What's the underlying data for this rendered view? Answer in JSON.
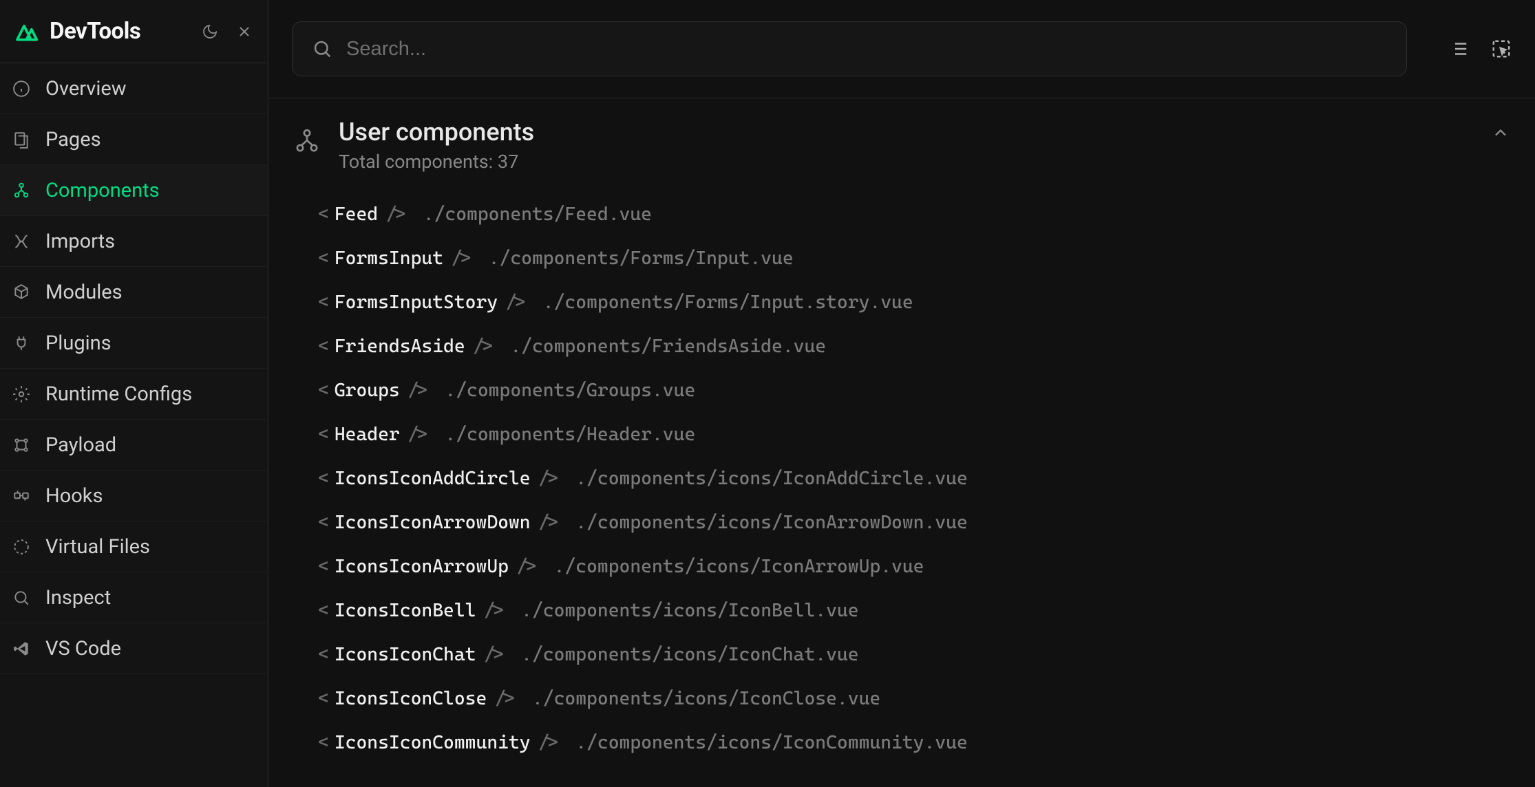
{
  "brand": "DevTools",
  "search": {
    "placeholder": "Search..."
  },
  "nav": {
    "items": [
      {
        "id": "overview",
        "label": "Overview"
      },
      {
        "id": "pages",
        "label": "Pages"
      },
      {
        "id": "components",
        "label": "Components"
      },
      {
        "id": "imports",
        "label": "Imports"
      },
      {
        "id": "modules",
        "label": "Modules"
      },
      {
        "id": "plugins",
        "label": "Plugins"
      },
      {
        "id": "runtime-configs",
        "label": "Runtime Configs"
      },
      {
        "id": "payload",
        "label": "Payload"
      },
      {
        "id": "hooks",
        "label": "Hooks"
      },
      {
        "id": "virtual-files",
        "label": "Virtual Files"
      },
      {
        "id": "inspect",
        "label": "Inspect"
      },
      {
        "id": "vscode",
        "label": "VS Code"
      }
    ],
    "active": "components"
  },
  "section": {
    "title": "User components",
    "subtitle_prefix": "Total components: ",
    "total": 37
  },
  "components": [
    {
      "name": "Feed",
      "path": "./components/Feed.vue"
    },
    {
      "name": "FormsInput",
      "path": "./components/Forms/Input.vue"
    },
    {
      "name": "FormsInputStory",
      "path": "./components/Forms/Input.story.vue"
    },
    {
      "name": "FriendsAside",
      "path": "./components/FriendsAside.vue"
    },
    {
      "name": "Groups",
      "path": "./components/Groups.vue"
    },
    {
      "name": "Header",
      "path": "./components/Header.vue"
    },
    {
      "name": "IconsIconAddCircle",
      "path": "./components/icons/IconAddCircle.vue"
    },
    {
      "name": "IconsIconArrowDown",
      "path": "./components/icons/IconArrowDown.vue"
    },
    {
      "name": "IconsIconArrowUp",
      "path": "./components/icons/IconArrowUp.vue"
    },
    {
      "name": "IconsIconBell",
      "path": "./components/icons/IconBell.vue"
    },
    {
      "name": "IconsIconChat",
      "path": "./components/icons/IconChat.vue"
    },
    {
      "name": "IconsIconClose",
      "path": "./components/icons/IconClose.vue"
    },
    {
      "name": "IconsIconCommunity",
      "path": "./components/icons/IconCommunity.vue"
    }
  ],
  "icons": {
    "overview": "info-icon",
    "pages": "pages-icon",
    "components": "tree-icon",
    "imports": "imports-icon",
    "modules": "modules-icon",
    "plugins": "plug-icon",
    "runtime-configs": "gear-icon",
    "payload": "payload-icon",
    "hooks": "hooks-icon",
    "virtual-files": "dashed-circle-icon",
    "inspect": "search-icon",
    "vscode": "vscode-icon"
  }
}
